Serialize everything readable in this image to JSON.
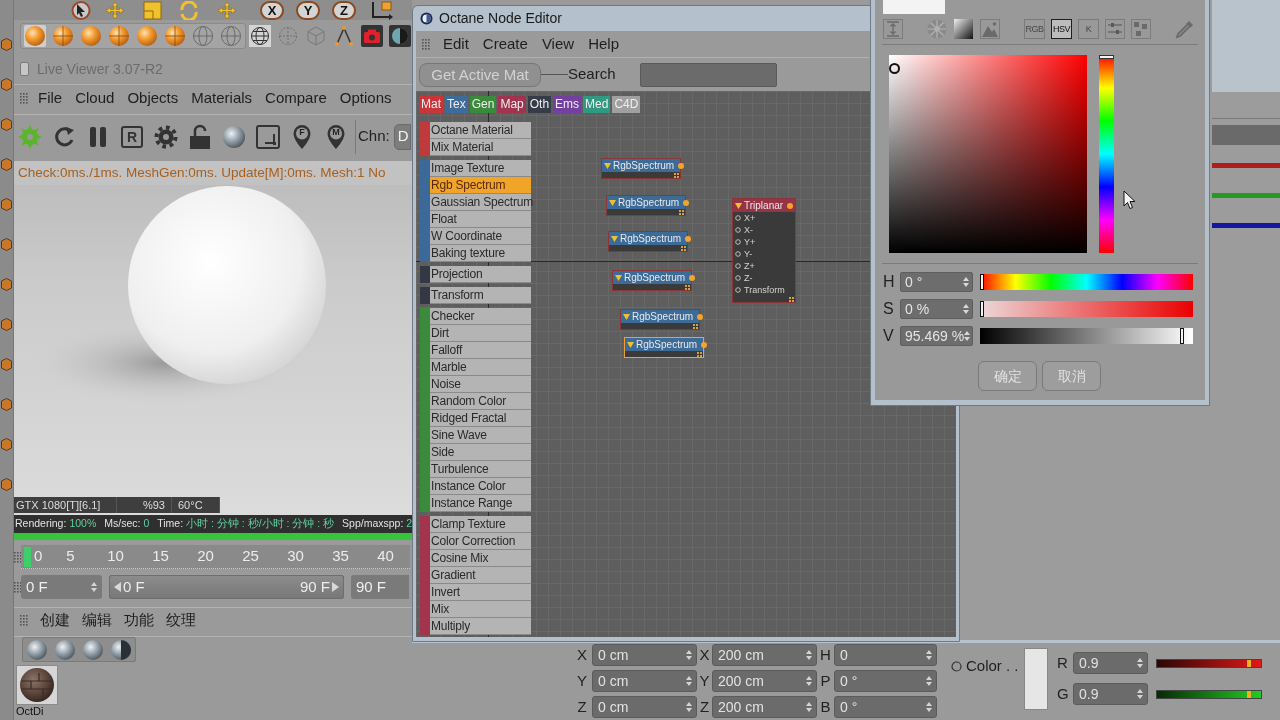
{
  "main_toolbar": {
    "axis_buttons": [
      {
        "label": "X"
      },
      {
        "label": "Y"
      },
      {
        "label": "Z"
      }
    ]
  },
  "live_viewer": {
    "title": "Live Viewer 3.07-R2",
    "menu": [
      "File",
      "Cloud",
      "Objects",
      "Materials",
      "Compare",
      "Options"
    ],
    "toolbar": [
      {
        "kind": "start"
      },
      {
        "kind": "refresh"
      },
      {
        "kind": "pause"
      },
      {
        "kind": "letter",
        "label": "R"
      },
      {
        "kind": "settings"
      },
      {
        "kind": "lock"
      },
      {
        "kind": "sphere"
      },
      {
        "kind": "region"
      },
      {
        "kind": "pin",
        "label": "F"
      },
      {
        "kind": "pin",
        "label": "M"
      }
    ],
    "channel": {
      "label": "Chn:",
      "value": "D"
    },
    "status": "Check:0ms./1ms. MeshGen:0ms. Update[M]:0ms. Mesh:1 No",
    "gpu_info": [
      "GTX 1080[T][6.1]",
      "%93",
      "60°C"
    ],
    "render_stats": [
      {
        "label": "Rendering:",
        "value": "100%"
      },
      {
        "label": "Ms/sec:",
        "value": "0"
      },
      {
        "label": "Time:",
        "value": "小时 : 分钟 : 秒/小时 : 分钟 : 秒"
      },
      {
        "label": "Spp/maxspp:",
        "value": "2"
      }
    ],
    "progress": {
      "level": 1
    }
  },
  "timeline": {
    "ticks": [
      "0",
      "5",
      "10",
      "15",
      "20",
      "25",
      "30",
      "35",
      "40"
    ],
    "start_field": "0 F",
    "range": {
      "start": "0 F",
      "end": "90 F",
      "level": 1
    },
    "end_field": "90 F"
  },
  "material_manager": {
    "menu": [
      "创建",
      "编辑",
      "功能",
      "纹理"
    ],
    "materials": [
      {
        "name": "OctDi"
      }
    ]
  },
  "node_editor": {
    "title": "Octane Node Editor",
    "menu": [
      "Edit",
      "Create",
      "View",
      "Help"
    ],
    "get_active_button": "Get Active Mat",
    "search_label": "Search",
    "tabs": [
      {
        "label": "Mat",
        "color": "#c8363a"
      },
      {
        "label": "Tex",
        "color": "#3d6b9a"
      },
      {
        "label": "Gen",
        "color": "#3a8a3c"
      },
      {
        "label": "Map",
        "color": "#a2334f"
      },
      {
        "label": "Oth",
        "color": "#363b48"
      },
      {
        "label": "Ems",
        "color": "#7440a0"
      },
      {
        "label": "Med",
        "color": "#2f9a80"
      },
      {
        "label": "C4D",
        "color": "#a0a0a0"
      }
    ],
    "node_groups": [
      {
        "color": "#c0393b",
        "items": [
          {
            "label": "Octane Material",
            "selected": false
          },
          {
            "label": "Mix Material",
            "selected": false
          }
        ]
      },
      {
        "color": "#3b6a9a",
        "items": [
          {
            "label": "Image Texture",
            "selected": false
          },
          {
            "label": "Rgb Spectrum",
            "selected": true
          },
          {
            "label": "Gaussian Spectrum",
            "selected": false
          },
          {
            "label": "Float",
            "selected": false
          },
          {
            "label": "W Coordinate",
            "selected": false
          },
          {
            "label": "Baking texture",
            "selected": false
          }
        ]
      },
      {
        "color": "#343844",
        "items": [
          {
            "label": "Projection",
            "selected": false
          }
        ]
      },
      {
        "color": "#343844",
        "items": [
          {
            "label": "Transform",
            "selected": false
          }
        ]
      },
      {
        "color": "#3a8c3c",
        "items": [
          {
            "label": "Checker",
            "selected": false
          },
          {
            "label": "Dirt",
            "selected": false
          },
          {
            "label": "Falloff",
            "selected": false
          },
          {
            "label": "Marble",
            "selected": false
          },
          {
            "label": "Noise",
            "selected": false
          },
          {
            "label": "Random Color",
            "selected": false
          },
          {
            "label": "Ridged Fractal",
            "selected": false
          },
          {
            "label": "Sine Wave",
            "selected": false
          },
          {
            "label": "Side",
            "selected": false
          },
          {
            "label": "Turbulence",
            "selected": false
          },
          {
            "label": "Instance Color",
            "selected": false
          },
          {
            "label": "Instance Range",
            "selected": false
          }
        ]
      },
      {
        "color": "#a3344e",
        "items": [
          {
            "label": "Clamp Texture",
            "selected": false
          },
          {
            "label": "Color Correction",
            "selected": false
          },
          {
            "label": "Cosine Mix",
            "selected": false
          },
          {
            "label": "Gradient",
            "selected": false
          },
          {
            "label": "Invert",
            "selected": false
          },
          {
            "label": "Mix",
            "selected": false
          },
          {
            "label": "Multiply",
            "selected": false
          }
        ]
      }
    ],
    "nodes": [
      {
        "title": "RgbSpectrum",
        "kind": "texture",
        "selected": false
      },
      {
        "title": "RgbSpectrum",
        "kind": "texture",
        "selected": false
      },
      {
        "title": "RgbSpectrum",
        "kind": "texture",
        "selected": false
      },
      {
        "title": "RgbSpectrum",
        "kind": "texture",
        "selected": false
      },
      {
        "title": "RgbSpectrum",
        "kind": "texture",
        "selected": false
      },
      {
        "title": "RgbSpectrum",
        "kind": "texture",
        "selected": true
      },
      {
        "title": "Triplanar",
        "kind": "projection",
        "selected": false,
        "inputs": [
          "X+",
          "X-",
          "Y+",
          "Y-",
          "Z+",
          "Z-",
          "Transform"
        ]
      }
    ]
  },
  "color_picker": {
    "modes": [
      {
        "label": "RGB",
        "selected": false
      },
      {
        "label": "HSV",
        "selected": true
      },
      {
        "label": "K",
        "selected": false
      }
    ],
    "fields": [
      {
        "label": "H",
        "value": "0 °",
        "level": 0,
        "kind": "hue"
      },
      {
        "label": "S",
        "value": "0 %",
        "level": 0,
        "kind": "saturation"
      },
      {
        "label": "V",
        "value": "95.469 %",
        "level": 0.95469,
        "kind": "value"
      }
    ],
    "buttons": [
      "确定",
      "取消"
    ]
  },
  "coordinates": {
    "rows": [
      {
        "position_axis": "X",
        "position": "0 cm",
        "size_axis": "X",
        "size": "200 cm",
        "rotation_axis": "H",
        "rotation": "0"
      },
      {
        "position_axis": "Y",
        "position": "0 cm",
        "size_axis": "Y",
        "size": "200 cm",
        "rotation_axis": "P",
        "rotation": "0 °"
      },
      {
        "position_axis": "Z",
        "position": "0 cm",
        "size_axis": "Z",
        "size": "200 cm",
        "rotation_axis": "B",
        "rotation": "0 °"
      }
    ]
  },
  "color_attribute": {
    "label": "Color . .",
    "channels": [
      {
        "name": "R",
        "value": "0.9",
        "level": 0.9,
        "kind": "red"
      },
      {
        "name": "G",
        "value": "0.9",
        "level": 0.9,
        "kind": "green"
      }
    ]
  }
}
